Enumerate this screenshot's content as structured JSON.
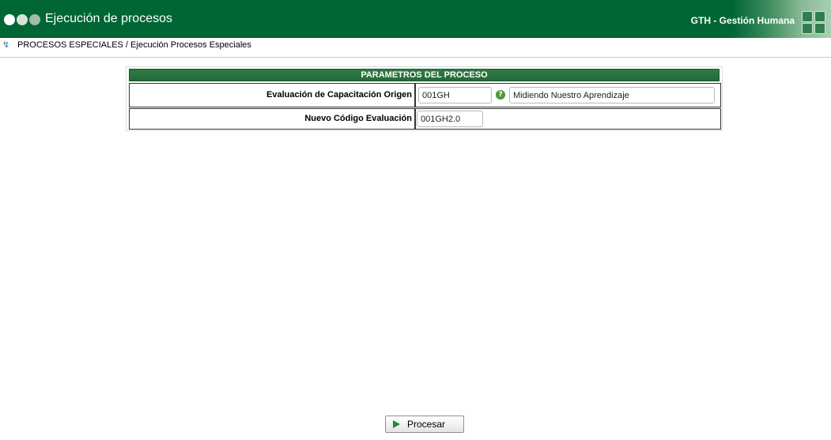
{
  "header": {
    "title": "Ejecución de procesos",
    "module": "GTH - Gestión Humana",
    "brand_color": "#006633"
  },
  "breadcrumb": {
    "icon": "info-arrow-icon",
    "text": "PROCESOS ESPECIALES / Ejecución Procesos Especiales"
  },
  "params": {
    "title": "PARAMETROS DEL PROCESO",
    "rows": [
      {
        "label": "Evaluación de Capacitación Origen",
        "code_value": "001GH",
        "description_value": "Midiendo Nuestro Aprendizaje",
        "help_icon": "help-icon"
      },
      {
        "label": "Nuevo Código Evaluación",
        "code_value": "001GH2.0"
      }
    ]
  },
  "actions": {
    "process_label": "Procesar",
    "process_icon": "play-icon"
  }
}
